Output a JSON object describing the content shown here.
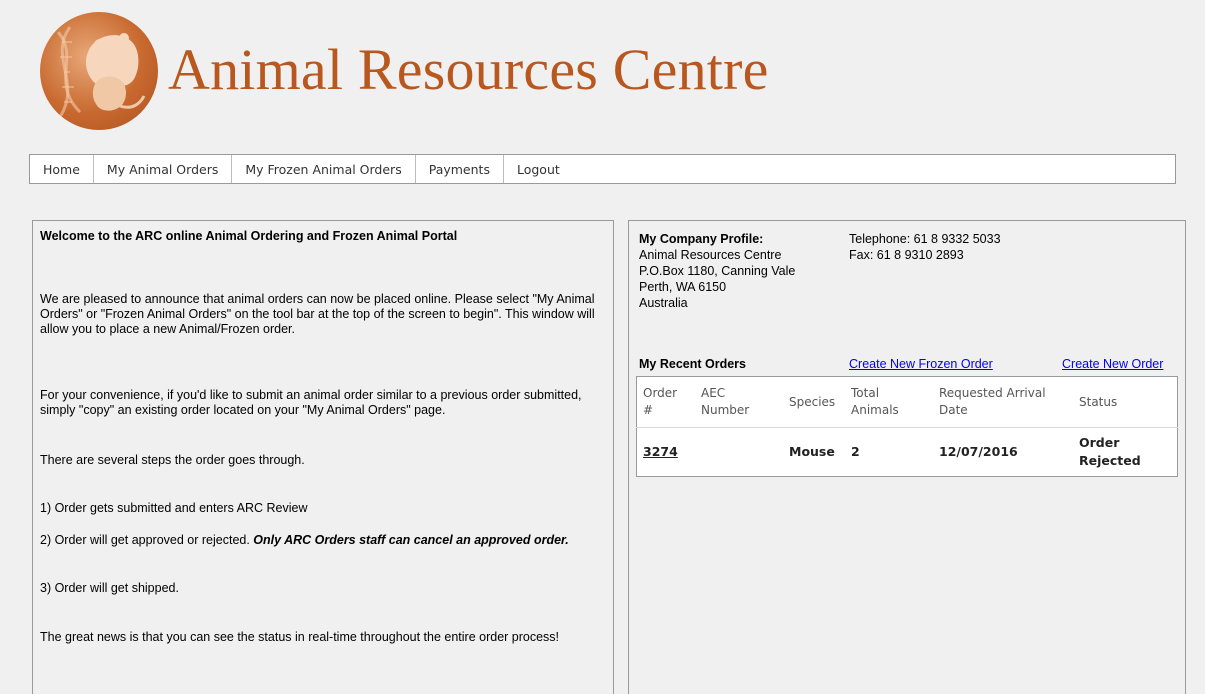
{
  "header": {
    "site_title": "Animal Resources Centre",
    "logo_icon": "rat-dna-logo-icon",
    "brand_color": "#b8571e"
  },
  "nav": {
    "items": [
      {
        "label": "Home"
      },
      {
        "label": "My Animal Orders"
      },
      {
        "label": "My Frozen Animal Orders"
      },
      {
        "label": "Payments"
      },
      {
        "label": "Logout"
      }
    ]
  },
  "welcome": {
    "title": "Welcome to the ARC online Animal Ordering and Frozen Animal Portal",
    "p1": "We are pleased to announce that animal orders can now be placed online. Please select \"My Animal Orders\" or \"Frozen Animal Orders\" on the tool bar at the top of the screen to begin\". This window will allow you to place a new Animal/Frozen order.",
    "p2": "For your convenience, if you'd like to submit an animal order similar to a previous order submitted, simply \"copy\" an existing order located on your \"My Animal Orders\" page.",
    "p3": "There are several steps the order goes through.",
    "step1": "1) Order gets submitted and enters ARC Review",
    "step2_plain": "2) Order will get approved or rejected. ",
    "step2_emph": "Only ARC Orders staff can cancel an approved order.",
    "step3": "3) Order will get shipped.",
    "p4": "The great news is that you can see the status in real-time throughout the entire order process!"
  },
  "profile": {
    "heading": "My Company Profile:",
    "company": "Animal Resources Centre",
    "address1": "P.O.Box 1180, Canning Vale",
    "address2": "Perth, WA 6150",
    "country": "Australia",
    "telephone": "Telephone: 61 8 9332 5033",
    "fax": "Fax: 61 8 9310 2893"
  },
  "recent": {
    "title": "My Recent Orders",
    "create_frozen": "Create New Frozen Order",
    "create_order": "Create New Order",
    "columns": [
      "Order #",
      "AEC Number",
      "Species",
      "Total Animals",
      "Requested Arrival Date",
      "Status"
    ],
    "rows": [
      {
        "order": "3274",
        "aec": "",
        "species": "Mouse",
        "total": "2",
        "date": "12/07/2016",
        "status": "Order Rejected"
      }
    ]
  }
}
